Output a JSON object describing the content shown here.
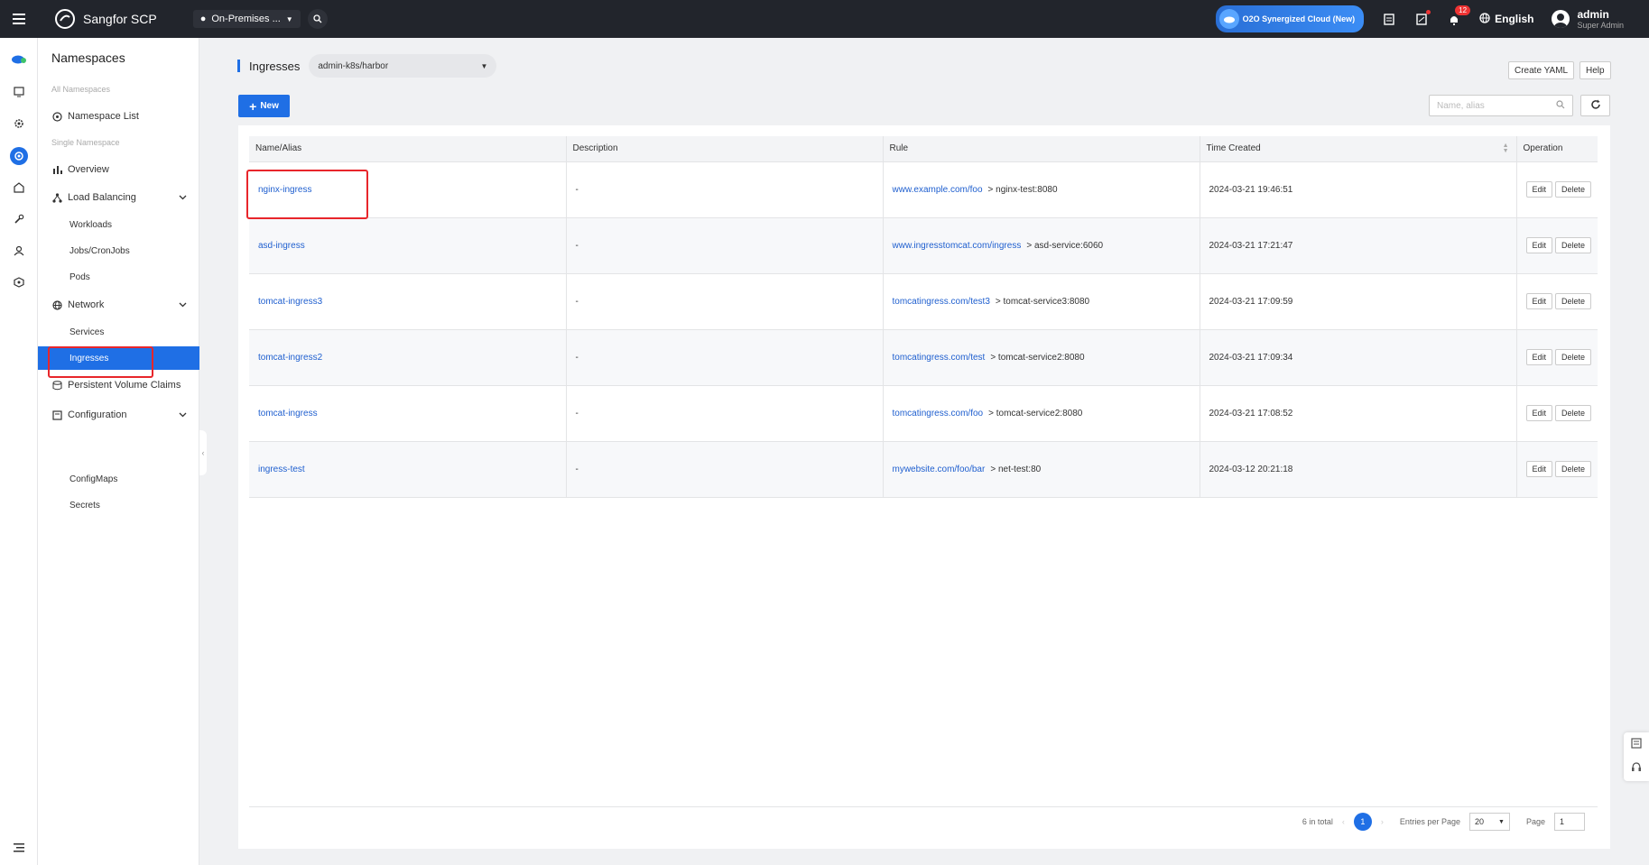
{
  "topbar": {
    "app_name": "Sangfor SCP",
    "site_select": "On-Premises ...",
    "o2o_label": "O2O Synergized Cloud (New)",
    "notification_count": "12",
    "language": "English",
    "user_name": "admin",
    "user_role": "Super Admin"
  },
  "sidenav": {
    "title": "Namespaces",
    "group_all": "All Namespaces",
    "namespace_list": "Namespace List",
    "group_single": "Single Namespace",
    "overview": "Overview",
    "load_balancing": "Load Balancing",
    "workloads": "Workloads",
    "jobs": "Jobs/CronJobs",
    "pods": "Pods",
    "network": "Network",
    "services": "Services",
    "ingresses": "Ingresses",
    "pvc": "Persistent Volume Claims",
    "configuration": "Configuration",
    "configmaps": "ConfigMaps",
    "secrets": "Secrets"
  },
  "main": {
    "title": "Ingresses",
    "namespace": "admin-k8s/harbor",
    "create_yaml": "Create YAML",
    "help": "Help",
    "new_button": "New",
    "search_placeholder": "Name, alias"
  },
  "table": {
    "headers": [
      "Name/Alias",
      "Description",
      "Rule",
      "Time Created",
      "Operation"
    ],
    "rows": [
      {
        "name": "nginx-ingress",
        "description": "-",
        "rule_host": "www.example.com/foo",
        "rule_target": "> nginx-test:8080",
        "time": "2024-03-21 19:46:51",
        "edit": "Edit",
        "delete": "Delete"
      },
      {
        "name": "asd-ingress",
        "description": "-",
        "rule_host": "www.ingresstomcat.com/ingress",
        "rule_target": "> asd-service:6060",
        "time": "2024-03-21 17:21:47",
        "edit": "Edit",
        "delete": "Delete"
      },
      {
        "name": "tomcat-ingress3",
        "description": "-",
        "rule_host": "tomcatingress.com/test3",
        "rule_target": "> tomcat-service3:8080",
        "time": "2024-03-21 17:09:59",
        "edit": "Edit",
        "delete": "Delete"
      },
      {
        "name": "tomcat-ingress2",
        "description": "-",
        "rule_host": "tomcatingress.com/test",
        "rule_target": "> tomcat-service2:8080",
        "time": "2024-03-21 17:09:34",
        "edit": "Edit",
        "delete": "Delete"
      },
      {
        "name": "tomcat-ingress",
        "description": "-",
        "rule_host": "tomcatingress.com/foo",
        "rule_target": "> tomcat-service2:8080",
        "time": "2024-03-21 17:08:52",
        "edit": "Edit",
        "delete": "Delete"
      },
      {
        "name": "ingress-test",
        "description": "-",
        "rule_host": "mywebsite.com/foo/bar",
        "rule_target": "> net-test:80",
        "time": "2024-03-12 20:21:18",
        "edit": "Edit",
        "delete": "Delete"
      }
    ]
  },
  "pagination": {
    "total": "6 in total",
    "current_page": "1",
    "entries_label": "Entries per Page",
    "entries_value": "20",
    "page_label": "Page",
    "page_value": "1"
  }
}
